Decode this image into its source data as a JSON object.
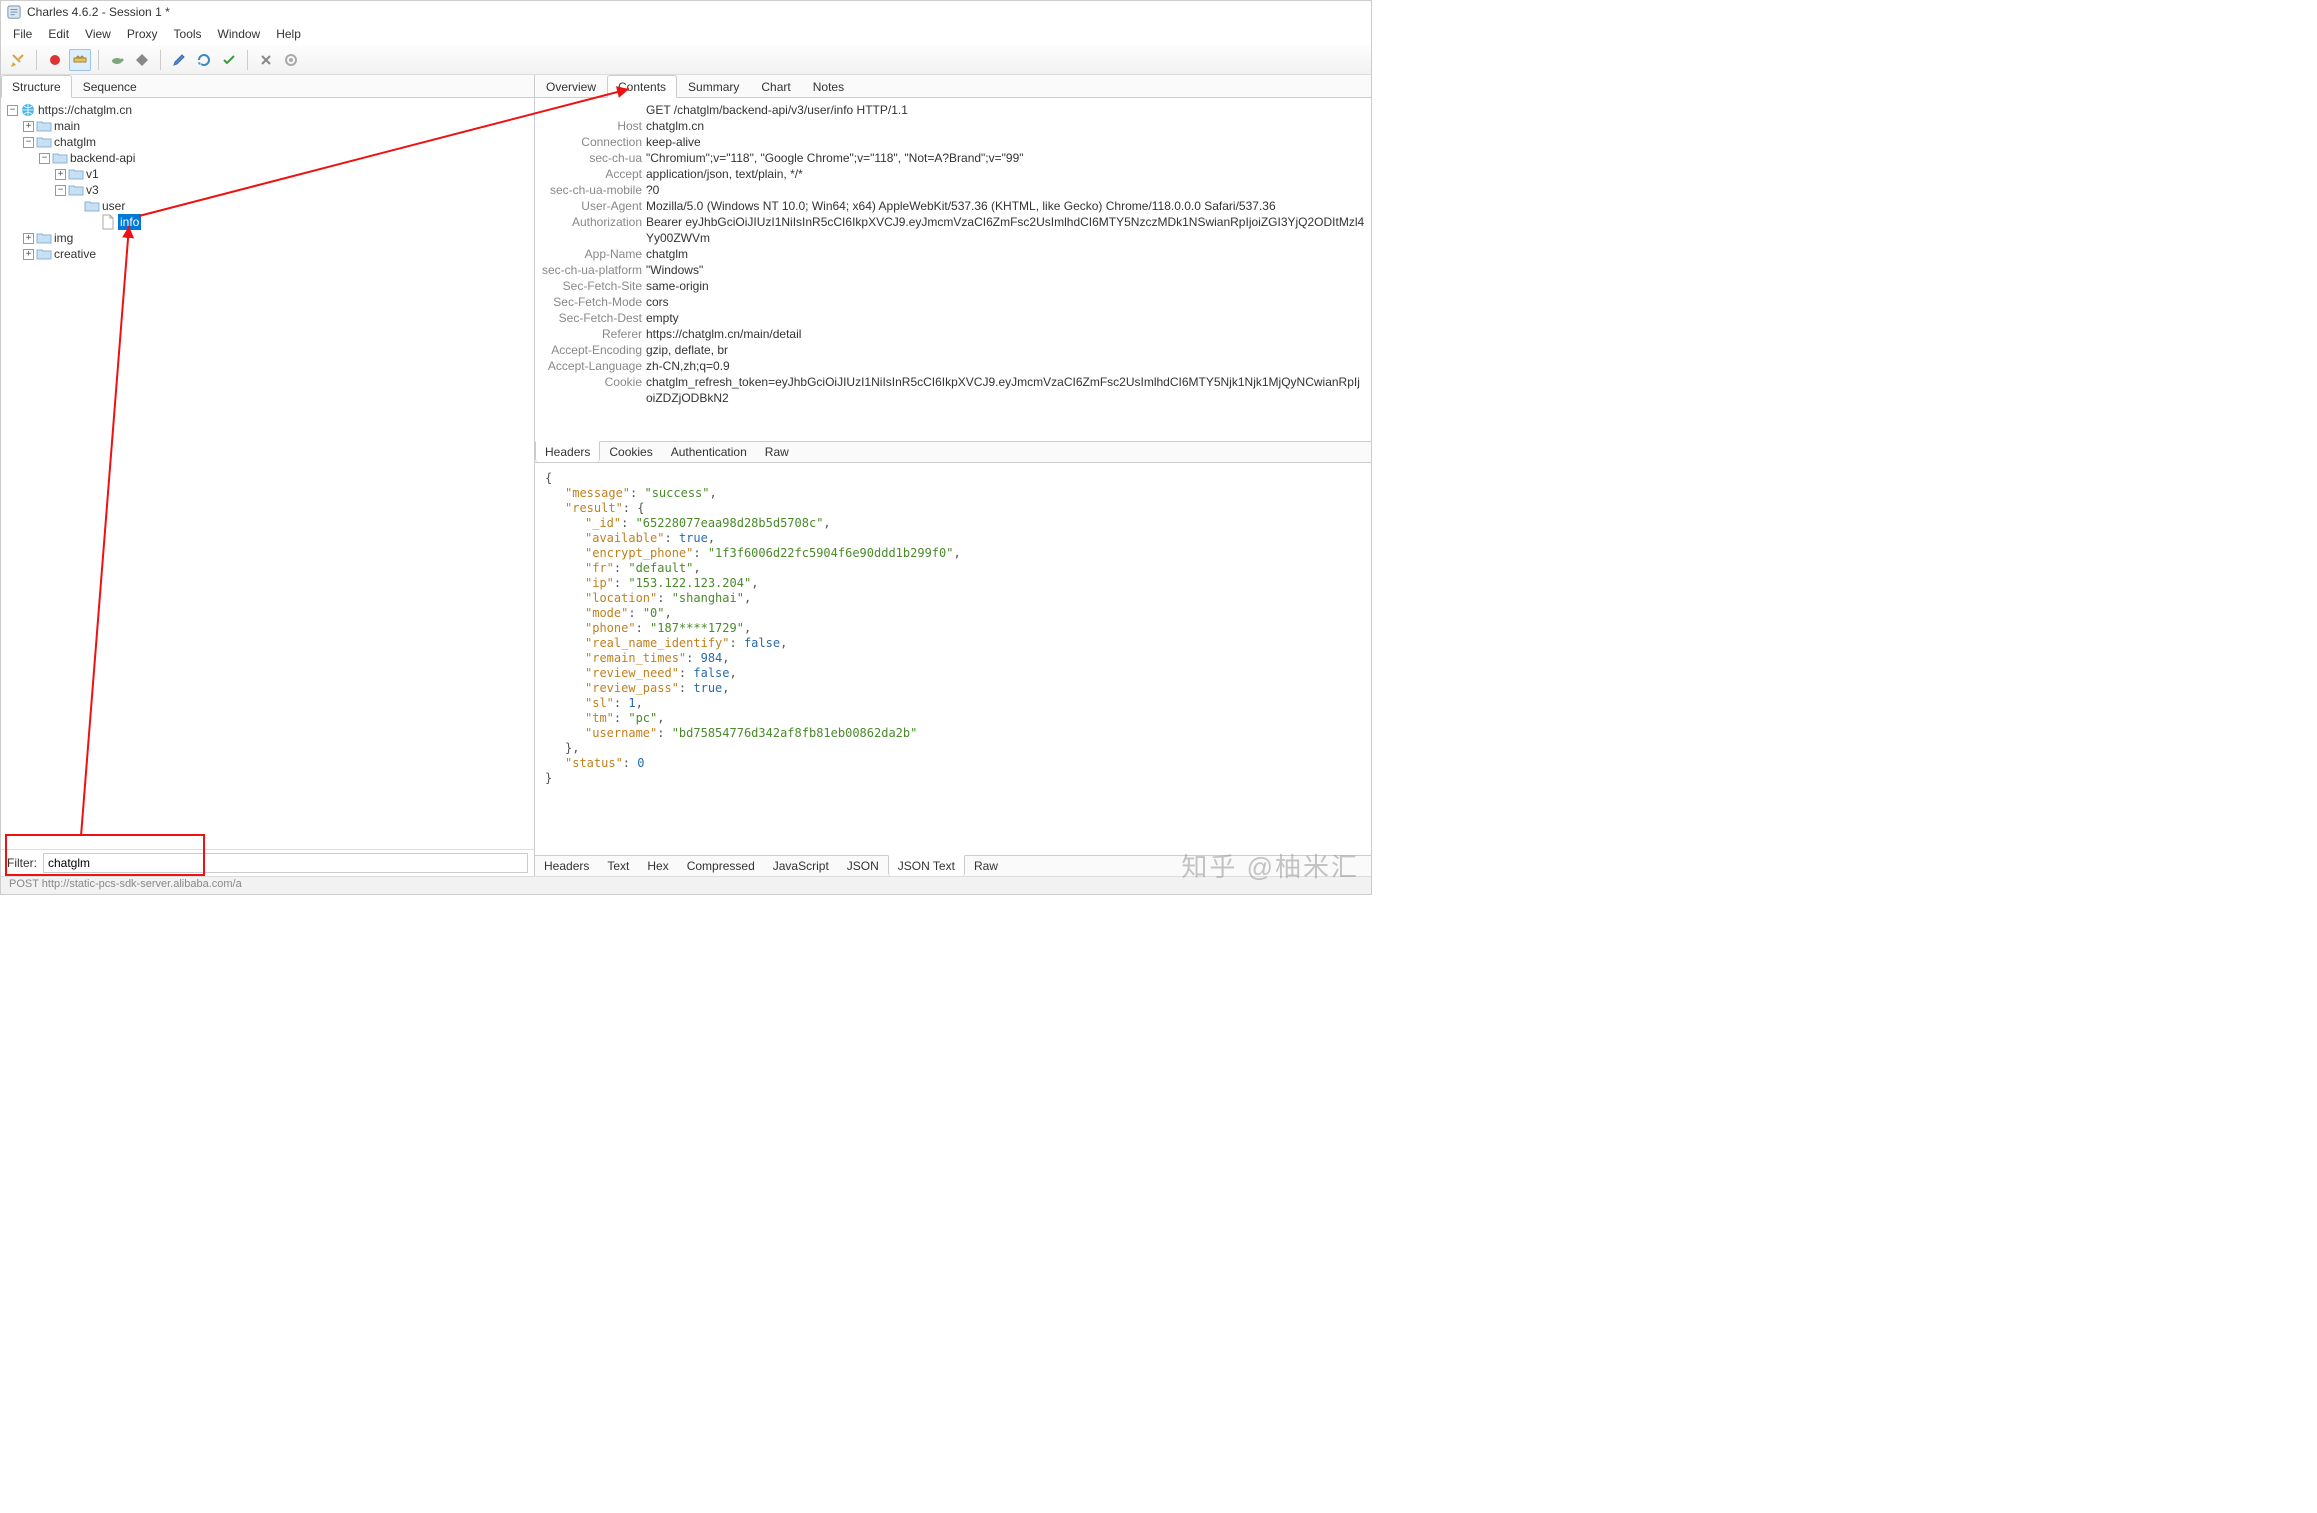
{
  "window": {
    "title": "Charles 4.6.2 - Session 1 *"
  },
  "menu": [
    "File",
    "Edit",
    "View",
    "Proxy",
    "Tools",
    "Window",
    "Help"
  ],
  "left_tabs": [
    {
      "label": "Structure",
      "active": true
    },
    {
      "label": "Sequence",
      "active": false
    }
  ],
  "tree": {
    "root_host": "https://chatglm.cn",
    "nodes": {
      "main": "main",
      "chatglm": "chatglm",
      "backend_api": "backend-api",
      "v1": "v1",
      "v3": "v3",
      "user": "user",
      "info": "info",
      "img": "img",
      "creative": "creative"
    }
  },
  "filter": {
    "label": "Filter:",
    "value": "chatglm"
  },
  "status_bar": "POST http://static-pcs-sdk-server.alibaba.com/a",
  "right_tabs": [
    {
      "label": "Overview",
      "active": false
    },
    {
      "label": "Contents",
      "active": true
    },
    {
      "label": "Summary",
      "active": false
    },
    {
      "label": "Chart",
      "active": false
    },
    {
      "label": "Notes",
      "active": false
    }
  ],
  "request": {
    "first_line": "GET /chatglm/backend-api/v3/user/info HTTP/1.1",
    "headers": [
      {
        "k": "Host",
        "v": "chatglm.cn"
      },
      {
        "k": "Connection",
        "v": "keep-alive"
      },
      {
        "k": "sec-ch-ua",
        "v": "\"Chromium\";v=\"118\", \"Google Chrome\";v=\"118\", \"Not=A?Brand\";v=\"99\""
      },
      {
        "k": "Accept",
        "v": "application/json, text/plain, */*"
      },
      {
        "k": "sec-ch-ua-mobile",
        "v": "?0"
      },
      {
        "k": "User-Agent",
        "v": "Mozilla/5.0 (Windows NT 10.0; Win64; x64) AppleWebKit/537.36 (KHTML, like Gecko) Chrome/118.0.0.0 Safari/537.36"
      },
      {
        "k": "Authorization",
        "v": "Bearer eyJhbGciOiJIUzI1NiIsInR5cCI6IkpXVCJ9.eyJmcmVzaCI6ZmFsc2UsImlhdCI6MTY5NzczMDk1NSwianRpIjoiZGI3YjQ2ODItMzl4Yy00ZWVm"
      },
      {
        "k": "App-Name",
        "v": "chatglm"
      },
      {
        "k": "sec-ch-ua-platform",
        "v": "\"Windows\""
      },
      {
        "k": "Sec-Fetch-Site",
        "v": "same-origin"
      },
      {
        "k": "Sec-Fetch-Mode",
        "v": "cors"
      },
      {
        "k": "Sec-Fetch-Dest",
        "v": "empty"
      },
      {
        "k": "Referer",
        "v": "https://chatglm.cn/main/detail"
      },
      {
        "k": "Accept-Encoding",
        "v": "gzip, deflate, br"
      },
      {
        "k": "Accept-Language",
        "v": "zh-CN,zh;q=0.9"
      },
      {
        "k": "Cookie",
        "v": "chatglm_refresh_token=eyJhbGciOiJIUzI1NiIsInR5cCI6IkpXVCJ9.eyJmcmVzaCI6ZmFsc2UsImlhdCI6MTY5Njk1Njk1MjQyNCwianRpIjoiZDZjODBkN2"
      }
    ]
  },
  "req_sub_tabs": [
    "Headers",
    "Cookies",
    "Authentication",
    "Raw"
  ],
  "req_sub_active": 0,
  "response_json": {
    "message": "success",
    "result": {
      "_id": "65228077eaa98d28b5d5708c",
      "available": true,
      "encrypt_phone": "1f3f6006d22fc5904f6e90ddd1b299f0",
      "fr": "default",
      "ip": "153.122.123.204",
      "location": "shanghai",
      "mode": "0",
      "phone": "187****1729",
      "real_name_identify": false,
      "remain_times": 984,
      "review_need": false,
      "review_pass": true,
      "sl": 1,
      "tm": "pc",
      "username": "bd75854776d342af8fb81eb00862da2b"
    },
    "status": 0
  },
  "res_sub_tabs": [
    "Headers",
    "Text",
    "Hex",
    "Compressed",
    "JavaScript",
    "JSON",
    "JSON Text",
    "Raw"
  ],
  "res_sub_active": 6,
  "watermark": "知乎 @柚米汇"
}
